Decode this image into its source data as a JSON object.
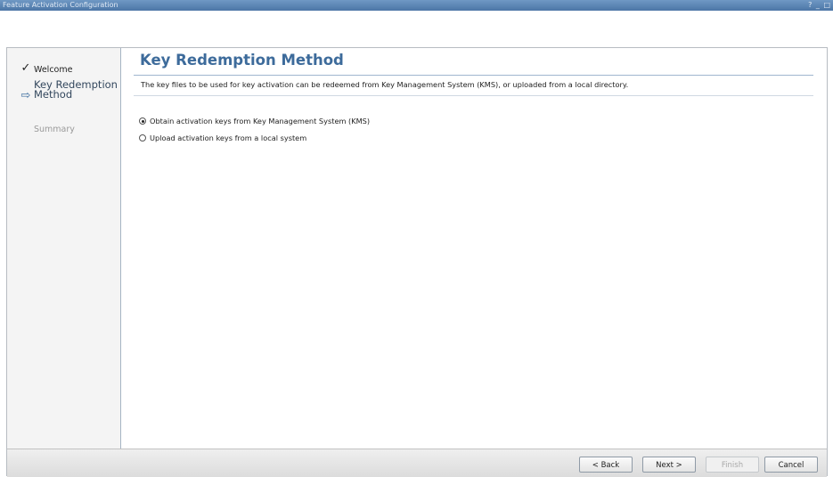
{
  "window": {
    "title": "Feature Activation Configuration",
    "controls": "? _ □"
  },
  "nav": {
    "steps": [
      {
        "label": "Welcome",
        "state": "completed",
        "icon": "checkmark-icon"
      },
      {
        "label": "Key Redemption Method",
        "state": "current",
        "icon": "arrow-right-icon"
      },
      {
        "label": "Summary",
        "state": "pending",
        "icon": ""
      }
    ]
  },
  "main": {
    "heading": "Key Redemption Method",
    "description": "The key files to be used for key activation can be redeemed from Key Management System (KMS), or uploaded from a local directory.",
    "options": [
      {
        "label": "Obtain activation keys from Key Management System (KMS)",
        "selected": true
      },
      {
        "label": "Upload activation keys from a local system",
        "selected": false
      }
    ]
  },
  "footer": {
    "back_label": "< Back",
    "next_label": "Next >",
    "finish_label": "Finish",
    "cancel_label": "Cancel"
  },
  "colors": {
    "titlebar": "#5a82b0",
    "heading": "#3d6b9b",
    "current_step_arrow": "#3b6d9e",
    "disabled_text": "#9a9a9a"
  }
}
